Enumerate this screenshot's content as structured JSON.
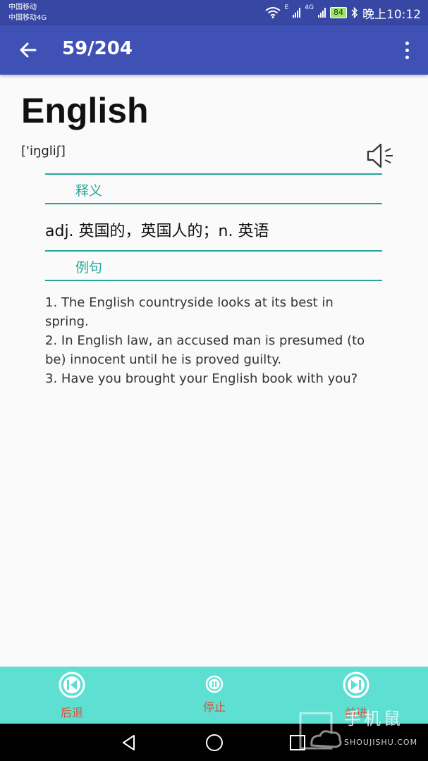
{
  "status_bar": {
    "carrier_1": "中国移动",
    "carrier_2": "中国移动4G",
    "network_1": "E",
    "network_2": "4G",
    "battery": "84",
    "time": "晚上10:12"
  },
  "app_bar": {
    "title": "59/204"
  },
  "word": {
    "text": "English",
    "phonetic": "['iŋgliʃ]"
  },
  "sections": {
    "definition_label": "释义",
    "definition": "adj. 英国的，英国人的；n. 英语",
    "examples_label": "例句",
    "examples": [
      "1. The English countryside looks at its best in spring.",
      "2. In English law, an accused man is presumed (to be) innocent until he is proved guilty.",
      "3. Have you brought your English book with you?"
    ]
  },
  "controls": {
    "prev_label": "后退",
    "stop_label": "停止",
    "next_label": "前进",
    "accent_color": "#d9533c",
    "bar_color": "#5ddfd1"
  },
  "watermark": {
    "text": "手机鼠",
    "sub": "SHOUJISHU.COM"
  }
}
